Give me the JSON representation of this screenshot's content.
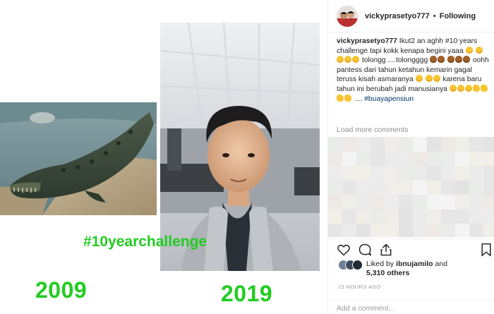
{
  "media": {
    "year_left": "2009",
    "year_right": "2019",
    "hashtag_overlay": "#10yearchallenge"
  },
  "header": {
    "username": "vickyprasetyo777",
    "separator": "•",
    "follow_status": "Following"
  },
  "caption": {
    "username": "vickyprasetyo777",
    "text_1": "Ikut2 an aghh #10 years challenge tapi kokk kenapa begini yaaa",
    "text_2": "tolongg ....tolongggg",
    "text_3": "oohh pantess dari tahun ketahun kemarin gagal teruss kisah asmaranya",
    "text_4": "karena baru tahun ini berubah jadi manusianya",
    "text_5": "....",
    "hashtag": "#buayapensiun"
  },
  "comments": {
    "load_more_label": "Load more comments"
  },
  "actions": {
    "like_icon": "heart-icon",
    "comment_icon": "comment-icon",
    "share_icon": "share-icon",
    "save_icon": "bookmark-icon"
  },
  "likes": {
    "prefix": "Liked by",
    "user": "ibnujamilo",
    "conj": "and",
    "count": "5,310 others"
  },
  "timestamp": "15 HOURS AGO",
  "add_comment": {
    "placeholder": "Add a comment..."
  },
  "colors": {
    "accent_green": "#22cc22",
    "hashtag_blue": "#003569",
    "muted_gray": "#8e8e8e"
  }
}
